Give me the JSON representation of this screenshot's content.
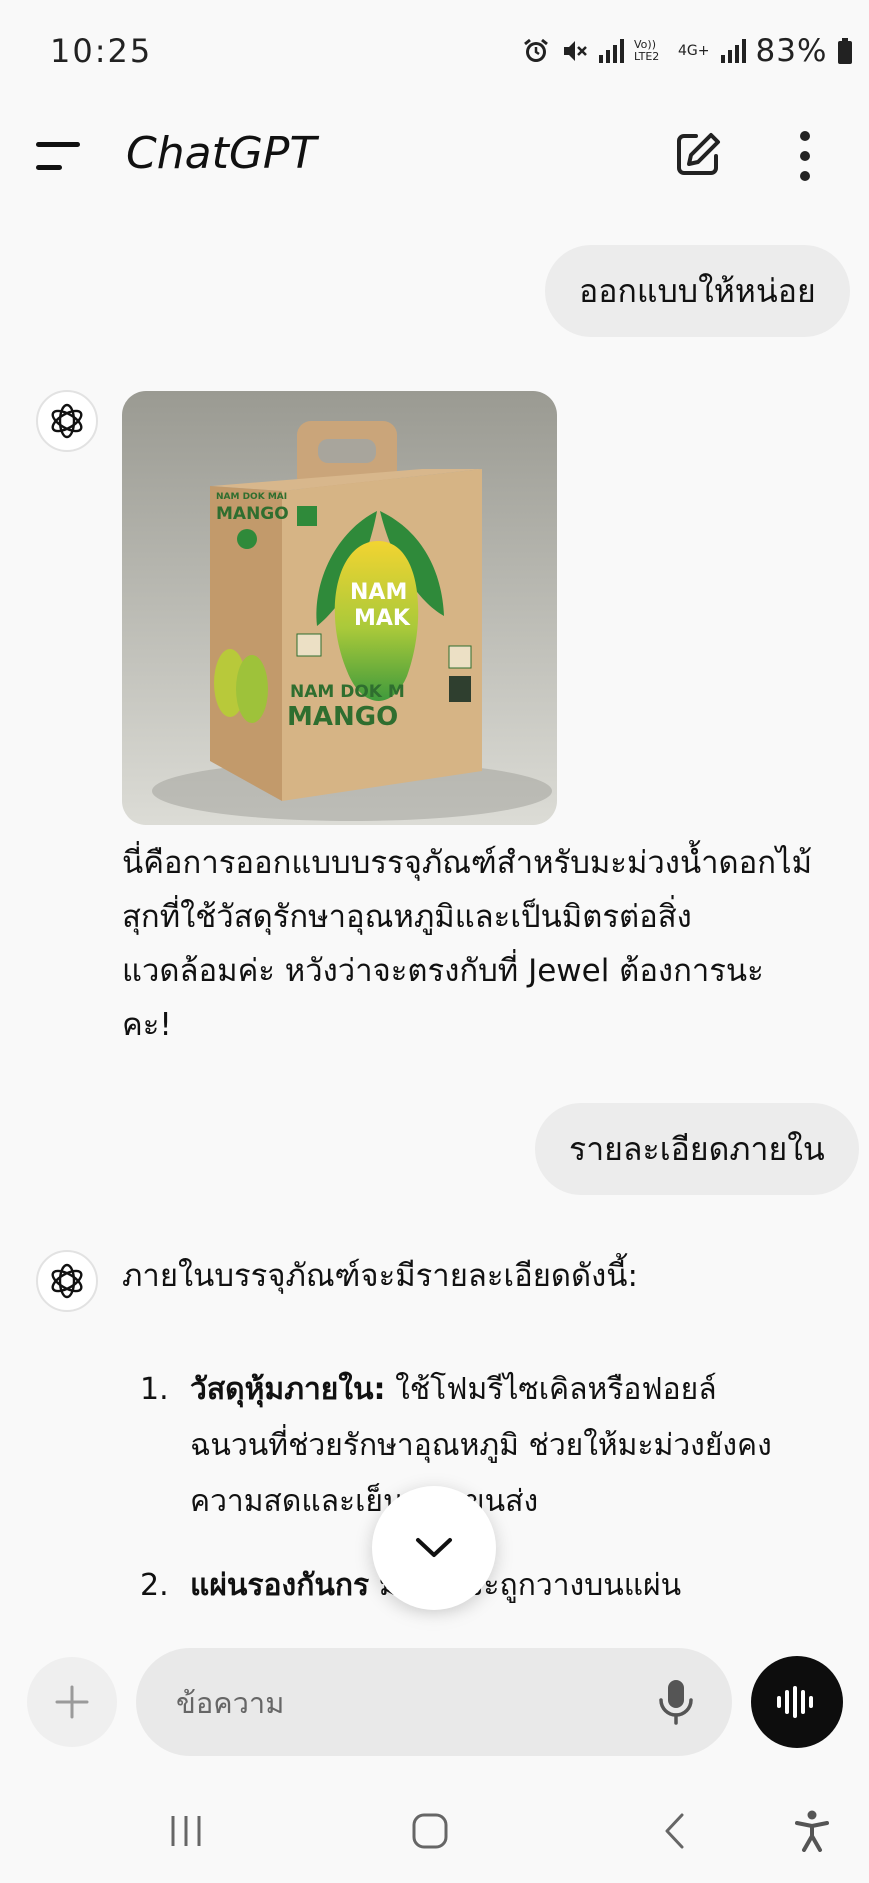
{
  "status_bar": {
    "time": "10:25",
    "network_label": "Vo)) LTE2",
    "network_type": "4G+",
    "battery": "83%"
  },
  "header": {
    "title": "ChatGPT",
    "menu_icon": "hamburger-icon",
    "edit_icon": "new-chat-icon",
    "more_icon": "more-vertical-icon"
  },
  "chat": {
    "message1": {
      "role": "user",
      "text": "ออกแบบให้หน่อย"
    },
    "message2": {
      "role": "assistant",
      "image": {
        "box_text_left": "NAM DOK MAI",
        "box_text_left2": "MANGO",
        "box_text_mango": "NAM",
        "box_text_mango2": "MAK",
        "box_text_bottom": "NAM DOK M",
        "box_text_bottom2": "MANGO"
      },
      "lines": [
        "นี่คือการออกแบบบรรจุภัณฑ์สำหรับมะม่วงน้ำดอกไม้",
        "สุกที่ใช้วัสดุรักษาอุณหภูมิและเป็นมิตรต่อสิ่ง",
        "แวดล้อมค่ะ หวังว่าจะตรงกับที่ Jewel ต้องการนะ",
        "คะ!"
      ]
    },
    "message3": {
      "role": "user",
      "text": "รายละเอียดภายใน"
    },
    "message4": {
      "role": "assistant",
      "intro": "ภายในบรรจุภัณฑ์จะมีรายละเอียดดังนี้:",
      "items": [
        {
          "num": "1.",
          "title": "วัสดุหุ้มภายใน:",
          "line1": " ใช้โฟมรีไซเคิลหรือฟอยล์",
          "line2": "ฉนวนที่ช่วยรักษาอุณหภูมิ ช่วยให้มะม่วงยังคง",
          "line3": "ความสดและเย็น      การขนส่ง"
        },
        {
          "num": "2.",
          "title": "แผ่นรองกันกร",
          "line1": "          มะม่วงจะถูกวางบนแผ่น"
        }
      ]
    }
  },
  "composer": {
    "placeholder": "ข้อความ",
    "plus_icon": "plus-icon",
    "mic_icon": "microphone-icon",
    "voice_icon": "voice-mode-icon"
  },
  "colors": {
    "background": "#f9f9f9",
    "user_bubble": "#ececec",
    "voice_button": "#0d0d0d"
  }
}
